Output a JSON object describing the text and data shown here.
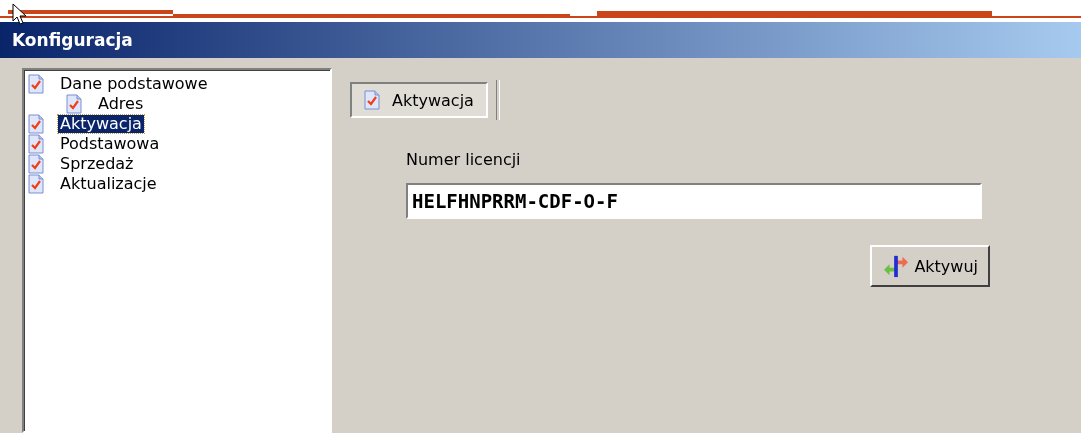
{
  "window": {
    "title": "Konfiguracja"
  },
  "tree": [
    {
      "label": "Dane podstawowe",
      "selected": false,
      "children": [
        {
          "label": "Adres",
          "selected": false
        }
      ]
    },
    {
      "label": "Aktywacja",
      "selected": true
    },
    {
      "label": "Podstawowa",
      "selected": false
    },
    {
      "label": "Sprzedaż",
      "selected": false
    },
    {
      "label": "Aktualizacje",
      "selected": false
    }
  ],
  "tabs": [
    {
      "label": "Aktywacja",
      "selected": true
    }
  ],
  "license": {
    "label": "Numer licencji",
    "value": "HELFHNPRRM-CDF-O-F"
  },
  "buttons": [
    {
      "label": "Aktywuj"
    }
  ]
}
